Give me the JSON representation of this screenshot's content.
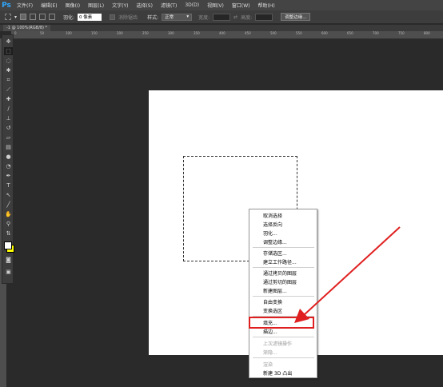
{
  "app": {
    "logo": "Ps"
  },
  "menubar": [
    "文件(F)",
    "编辑(E)",
    "图像(I)",
    "图层(L)",
    "文字(Y)",
    "选择(S)",
    "滤镜(T)",
    "3D(D)",
    "视图(V)",
    "窗口(W)",
    "帮助(H)"
  ],
  "options": {
    "feather_label": "羽化:",
    "feather_value": "0 像素",
    "antialias_label": "消除锯齿",
    "style_label": "样式:",
    "style_value": "正常",
    "width_label": "宽度:",
    "height_label": "高度:",
    "refine_button": "调整边缘..."
  },
  "document": {
    "tab_title": "-1 @ 100%(RGB/8) *"
  },
  "ruler": {
    "ticks": [
      "0",
      "50",
      "100",
      "150",
      "200",
      "250",
      "300",
      "350",
      "400",
      "450",
      "500",
      "550",
      "600",
      "650",
      "700",
      "750",
      "800"
    ]
  },
  "context_menu": {
    "items": [
      {
        "label": "取消选择",
        "enabled": true
      },
      {
        "label": "选择反向",
        "enabled": true
      },
      {
        "label": "羽化...",
        "enabled": true
      },
      {
        "label": "调整边缘...",
        "enabled": true
      },
      {
        "label": "存储选区...",
        "enabled": true
      },
      {
        "label": "建立工作路径...",
        "enabled": true
      },
      {
        "label": "通过拷贝的图层",
        "enabled": true
      },
      {
        "label": "通过剪切的图层",
        "enabled": true
      },
      {
        "label": "新建图层...",
        "enabled": true
      },
      {
        "label": "自由变换",
        "enabled": true
      },
      {
        "label": "变换选区",
        "enabled": true
      },
      {
        "label": "填充...",
        "enabled": true,
        "highlighted": true
      },
      {
        "label": "描边...",
        "enabled": true
      },
      {
        "label": "上次滤镜操作",
        "enabled": false
      },
      {
        "label": "渐隐...",
        "enabled": false
      },
      {
        "label": "渲染",
        "enabled": false
      },
      {
        "label": "新建 3D 凸出",
        "enabled": true
      }
    ]
  },
  "colors": {
    "canvas": "#ffffff",
    "annotation": "#e02020",
    "foreground": "#ffffff",
    "background": "#ffff00"
  }
}
